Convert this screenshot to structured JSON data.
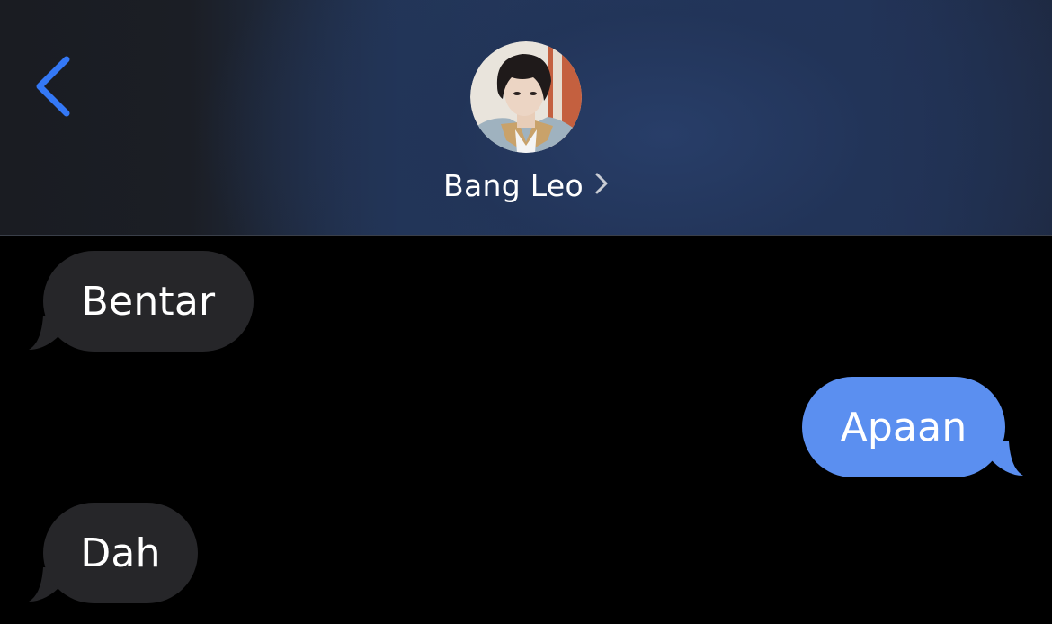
{
  "header": {
    "back_icon": "chevron-left-icon",
    "contact_name": "Bang Leo",
    "detail_icon": "chevron-right-icon",
    "accent_color": "#3478f6"
  },
  "messages": [
    {
      "direction": "incoming",
      "text": "Bentar"
    },
    {
      "direction": "outgoing",
      "text": "Apaan"
    },
    {
      "direction": "incoming",
      "text": "Dah"
    }
  ],
  "colors": {
    "incoming_bubble": "#262629",
    "outgoing_bubble": "#5b8ff0",
    "background": "#000000"
  }
}
